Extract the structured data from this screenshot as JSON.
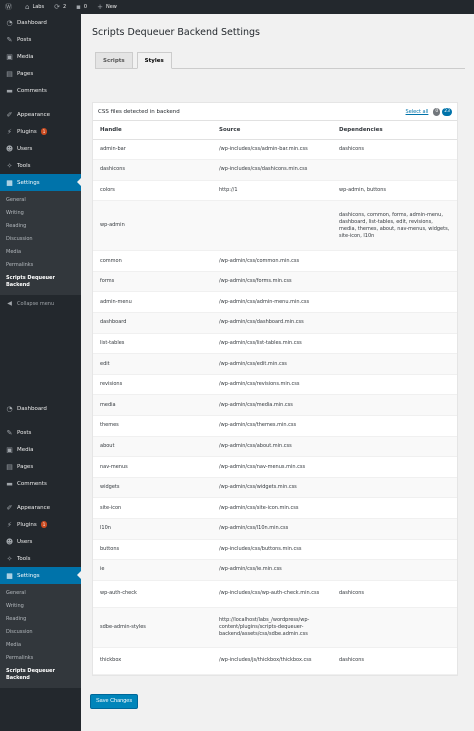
{
  "adminbar": {
    "site_name": "Labs",
    "updates": "2",
    "comments": "0",
    "new_label": "New"
  },
  "sidebar": {
    "dashboard": "Dashboard",
    "posts": "Posts",
    "media": "Media",
    "pages": "Pages",
    "comments": "Comments",
    "appearance": "Appearance",
    "plugins": "Plugins",
    "plugins_badge": "1",
    "users": "Users",
    "tools": "Tools",
    "settings": "Settings",
    "submenu": [
      "General",
      "Writing",
      "Reading",
      "Discussion",
      "Media",
      "Permalinks",
      "Scripts Dequeuer Backend"
    ],
    "collapse": "Collapse menu"
  },
  "page": {
    "title": "Scripts Dequeuer Backend Settings",
    "tabs": [
      "Scripts",
      "Styles"
    ],
    "active_tab": "Styles",
    "panel_title": "CSS files detected in backend",
    "select_all": "Select all",
    "selected_count": "0",
    "total_count": "23",
    "save_label": "Save Changes"
  },
  "table": {
    "headers": [
      "Handle",
      "Source",
      "Dependencies"
    ],
    "rows": [
      {
        "handle": "admin-bar",
        "source": "/wp-includes/css/admin-bar.min.css",
        "deps": "dashicons"
      },
      {
        "handle": "dashicons",
        "source": "/wp-includes/css/dashicons.min.css",
        "deps": ""
      },
      {
        "handle": "colors",
        "source": "http://1",
        "deps": "wp-admin, buttons"
      },
      {
        "handle": "wp-admin",
        "source": "",
        "deps": "dashicons, common, forms, admin-menu, dashboard, list-tables, edit, revisions, media, themes, about, nav-menus, widgets, site-icon, l10n"
      },
      {
        "handle": "common",
        "source": "/wp-admin/css/common.min.css",
        "deps": ""
      },
      {
        "handle": "forms",
        "source": "/wp-admin/css/forms.min.css",
        "deps": ""
      },
      {
        "handle": "admin-menu",
        "source": "/wp-admin/css/admin-menu.min.css",
        "deps": ""
      },
      {
        "handle": "dashboard",
        "source": "/wp-admin/css/dashboard.min.css",
        "deps": ""
      },
      {
        "handle": "list-tables",
        "source": "/wp-admin/css/list-tables.min.css",
        "deps": ""
      },
      {
        "handle": "edit",
        "source": "/wp-admin/css/edit.min.css",
        "deps": ""
      },
      {
        "handle": "revisions",
        "source": "/wp-admin/css/revisions.min.css",
        "deps": ""
      },
      {
        "handle": "media",
        "source": "/wp-admin/css/media.min.css",
        "deps": ""
      },
      {
        "handle": "themes",
        "source": "/wp-admin/css/themes.min.css",
        "deps": ""
      },
      {
        "handle": "about",
        "source": "/wp-admin/css/about.min.css",
        "deps": ""
      },
      {
        "handle": "nav-menus",
        "source": "/wp-admin/css/nav-menus.min.css",
        "deps": ""
      },
      {
        "handle": "widgets",
        "source": "/wp-admin/css/widgets.min.css",
        "deps": ""
      },
      {
        "handle": "site-icon",
        "source": "/wp-admin/css/site-icon.min.css",
        "deps": ""
      },
      {
        "handle": "l10n",
        "source": "/wp-admin/css/l10n.min.css",
        "deps": ""
      },
      {
        "handle": "buttons",
        "source": "/wp-includes/css/buttons.min.css",
        "deps": ""
      },
      {
        "handle": "ie",
        "source": "/wp-admin/css/ie.min.css",
        "deps": ""
      },
      {
        "handle": "wp-auth-check",
        "source": "/wp-includes/css/wp-auth-check.min.css",
        "deps": "dashicons"
      },
      {
        "handle": "sdbe-admin-styles",
        "source": "http://localhost/labs_/wordpress/wp-content/plugins/scripts-dequeuer-backend/assets/css/sdbe.admin.css",
        "deps": ""
      },
      {
        "handle": "thickbox",
        "source": "/wp-includes/js/thickbox/thickbox.css",
        "deps": "dashicons"
      }
    ]
  },
  "colors": {
    "accent": "#0073aa",
    "sidebar_bg": "#23282d",
    "badge": "#ca4a1f"
  }
}
